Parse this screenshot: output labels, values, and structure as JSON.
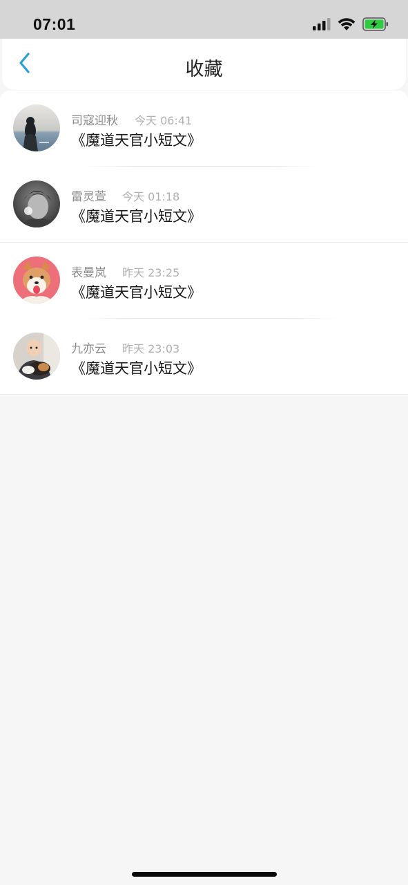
{
  "status_bar": {
    "time": "07:01"
  },
  "nav": {
    "title": "收藏",
    "back_icon": "chevron-left-icon"
  },
  "favorites": [
    {
      "name": "司寇迎秋",
      "time": "今天 06:41",
      "title": "《魔道天官小短文》",
      "avatar": "girl-by-sea-avatar"
    },
    {
      "name": "雷灵萱",
      "time": "今天 01:18",
      "title": "《魔道天官小短文》",
      "avatar": "bw-child-avatar"
    },
    {
      "name": "表曼岚",
      "time": "昨天 23:25",
      "title": "《魔道天官小短文》",
      "avatar": "shiba-dog-avatar"
    },
    {
      "name": "九亦云",
      "time": "昨天 23:03",
      "title": "《魔道天官小短文》",
      "avatar": "child-with-dog-avatar"
    }
  ],
  "colors": {
    "accent": "#2a9fd8",
    "status_bar_bg": "#d6d6d6",
    "page_bg": "#f6f6f6",
    "battery_fill": "#2ecc40"
  }
}
